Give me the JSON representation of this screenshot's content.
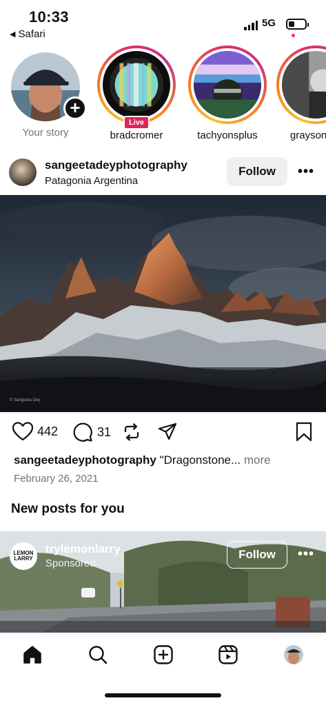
{
  "status_bar": {
    "time": "10:33",
    "back_app": "Safari",
    "network": "5G",
    "battery_level": 0.35
  },
  "stories": [
    {
      "name": "Your story",
      "own": true,
      "icon": "add-story-icon"
    },
    {
      "name": "bradcromer",
      "live": true,
      "live_label": "Live"
    },
    {
      "name": "tachyonsplus"
    },
    {
      "name": "graysonma"
    }
  ],
  "post": {
    "username": "sangeetadeyphotography",
    "location": "Patagonia Argentina",
    "follow_label": "Follow",
    "more_icon": "more-dots-icon",
    "image_watermark": "© Sangeeta Dey",
    "likes": "442",
    "comments": "31",
    "caption_user": "sangeetadeyphotography",
    "caption_text": " \"Dragonstone... ",
    "caption_more": "more",
    "date": "February 26, 2021"
  },
  "section_title": "New posts for you",
  "sponsored": {
    "avatar_text_top": "LEMON",
    "avatar_text_bottom": "LARRY",
    "username": "trylemonlarry",
    "subtitle": "Sponsored",
    "follow_label": "Follow"
  },
  "tab_bar": {
    "tabs": [
      "home-icon",
      "search-icon",
      "create-icon",
      "reels-icon",
      "profile-avatar"
    ],
    "active": "home-icon"
  },
  "colors": {
    "live_badge": "#e0245e",
    "notification_dot": "#ff3040",
    "secondary_text": "#737373"
  }
}
